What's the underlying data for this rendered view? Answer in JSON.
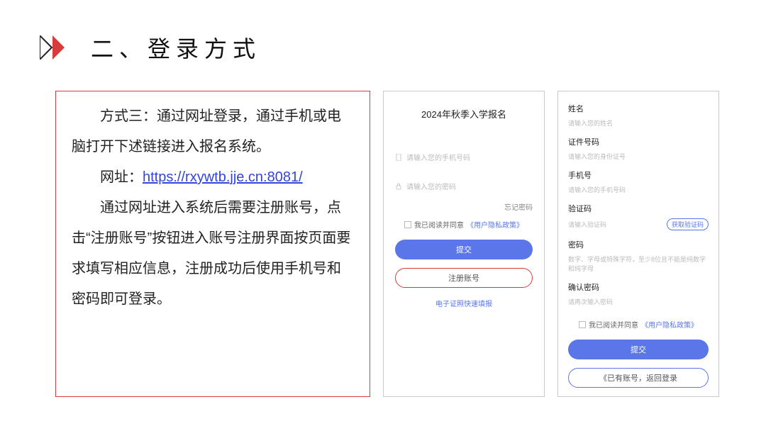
{
  "header": {
    "title": "二、登录方式"
  },
  "textbox": {
    "p1_a": "方式三：通过网址登录，通过手机或电脑打开下述链接进入报名系统。",
    "p2_prefix": "网址：",
    "p2_url": "https://rxywtb.jje.cn:8081/",
    "p3": "通过网址进入系统后需要注册账号，点击“注册账号”按钮进入账号注册界面按页面要求填写相应信息，注册成功后使用手机号和密码即可登录。"
  },
  "login": {
    "title": "2024年秋季入学报名",
    "phone_ph": "请输入您的手机号码",
    "pwd_ph": "请输入您的密码",
    "forgot": "忘记密码",
    "agree_text": "我已阅读并同意",
    "policy": "《用户隐私政策》",
    "submit": "提交",
    "register": "注册账号",
    "cert_link": "电子证照快速填报"
  },
  "reg": {
    "name_label": "姓名",
    "name_ph": "请输入您的姓名",
    "id_label": "证件号码",
    "id_ph": "请输入您的身份证号",
    "phone_label": "手机号",
    "phone_ph": "请输入您的手机号码",
    "code_label": "验证码",
    "code_ph": "请输入验证码",
    "get_code": "获取验证码",
    "pwd_label": "密码",
    "pwd_ph": "数字、字母或特殊字符，至少8位且不能是纯数字和纯字母",
    "pwd2_label": "确认密码",
    "pwd2_ph": "请再次输入密码",
    "agree_text": "我已阅读并同意",
    "policy": "《用户隐私政策》",
    "submit": "提交",
    "back": "《已有账号，返回登录"
  }
}
